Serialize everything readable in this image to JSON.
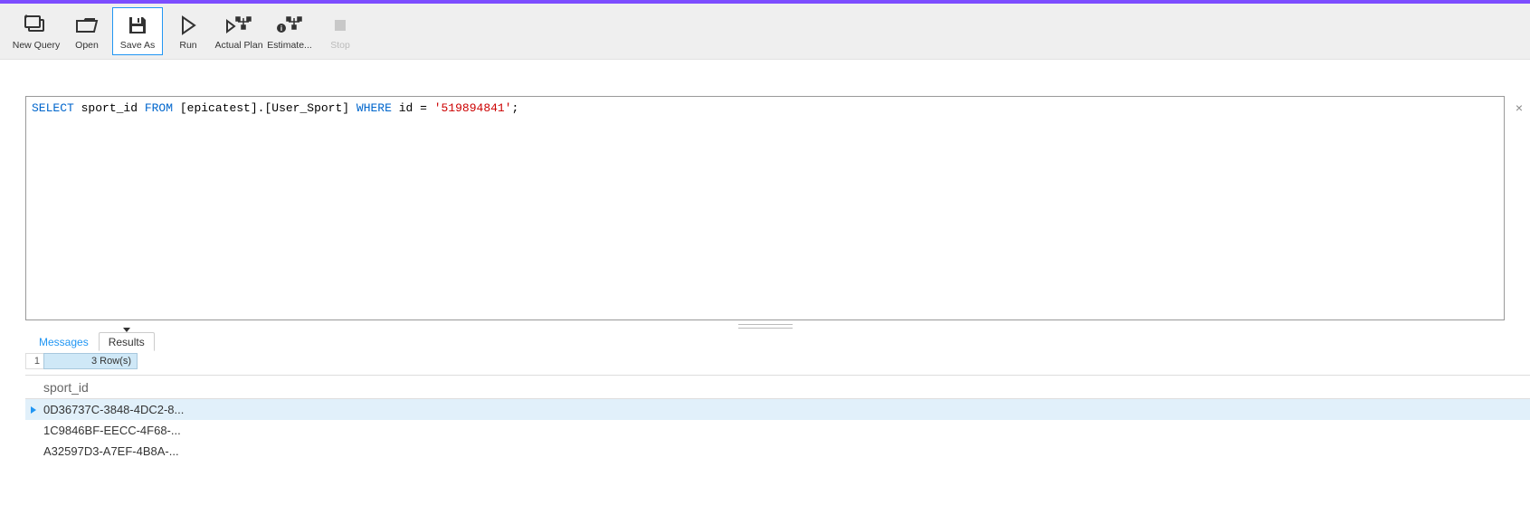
{
  "toolbar": {
    "items": [
      {
        "label": "New Query",
        "icon": "new-query"
      },
      {
        "label": "Open",
        "icon": "open"
      },
      {
        "label": "Save As",
        "icon": "save",
        "selected": true
      },
      {
        "label": "Run",
        "icon": "run"
      },
      {
        "label": "Actual Plan",
        "icon": "actual-plan"
      },
      {
        "label": "Estimate...",
        "icon": "estimate"
      },
      {
        "label": "Stop",
        "icon": "stop",
        "disabled": true
      }
    ]
  },
  "editor": {
    "sql": {
      "kw1": "SELECT",
      "col": " sport_id ",
      "kw2": "FROM",
      "tbl": " [epicatest].[User_Sport] ",
      "kw3": "WHERE",
      "cond": " id = ",
      "str": "'519894841'",
      "end": ";"
    }
  },
  "tabs": {
    "messages": "Messages",
    "results": "Results"
  },
  "status": {
    "seq": "1",
    "rows": "3  Row(s)"
  },
  "grid": {
    "column": "sport_id",
    "rows": [
      "0D36737C-3848-4DC2-8...",
      "1C9846BF-EECC-4F68-...",
      "A32597D3-A7EF-4B8A-..."
    ]
  },
  "close": "×"
}
